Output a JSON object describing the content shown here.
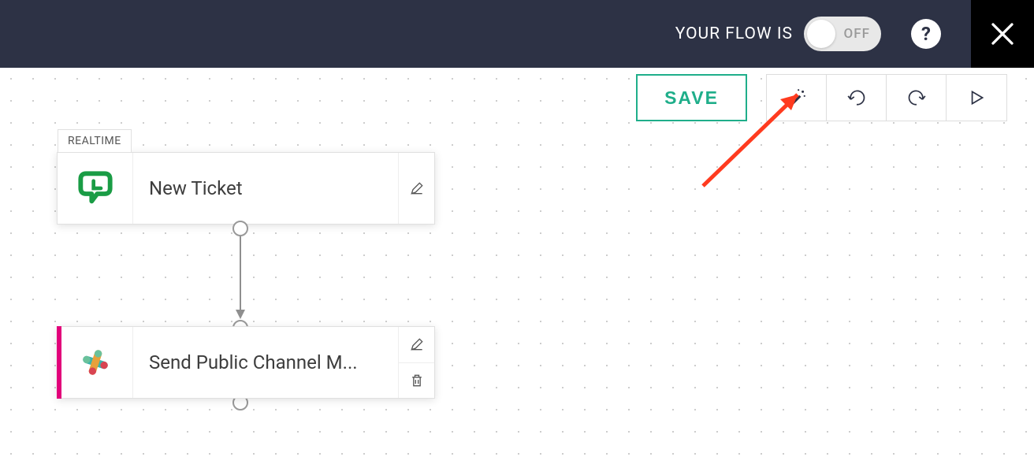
{
  "header": {
    "flow_label": "YOUR FLOW IS",
    "toggle_state": "OFF",
    "help": "?"
  },
  "toolbar": {
    "save_label": "SAVE"
  },
  "nodes": {
    "trigger": {
      "badge": "REALTIME",
      "title": "New Ticket",
      "app": "projoquick"
    },
    "action": {
      "title": "Send Public Channel M...",
      "app": "slack"
    }
  }
}
